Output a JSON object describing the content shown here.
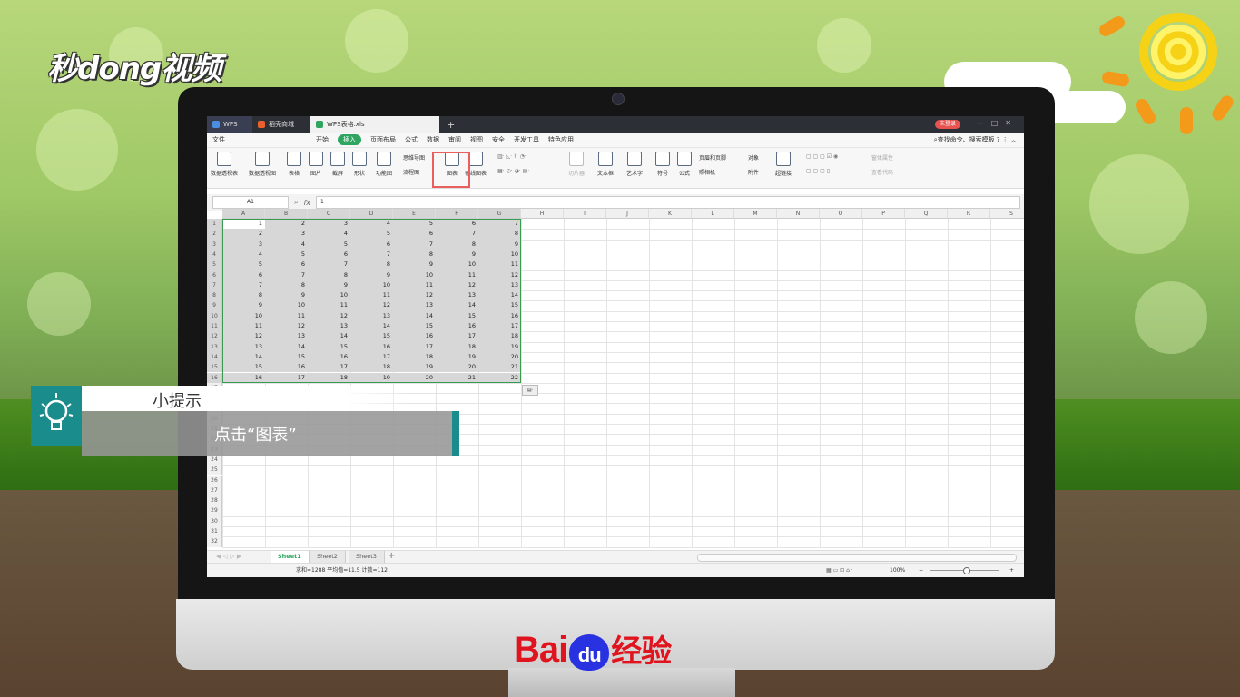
{
  "brand": {
    "top_logo": "秒dong视频",
    "baidu_logo_left": "Bai",
    "baidu_logo_paw": "du",
    "baidu_logo_right": "经验"
  },
  "tip": {
    "title": "小提示",
    "text": "点击“图表”"
  },
  "app": {
    "tabs": [
      {
        "label": "WPS"
      },
      {
        "label": "稻壳商城"
      },
      {
        "label": "WPS表格.xls"
      }
    ],
    "login_label": "未登录",
    "menu": [
      "文件",
      "开始",
      "插入",
      "页面布局",
      "公式",
      "数据",
      "审阅",
      "视图",
      "安全",
      "开发工具",
      "特色应用"
    ],
    "active_menu": "插入",
    "search_label": "查找命令、搜索模板",
    "ribbon": {
      "pivot_table": "数据透视表",
      "pivot_chart": "数据透视图",
      "table": "表格",
      "picture": "图片",
      "screenshot": "截屏",
      "shape": "形状",
      "function_chart": "功能图",
      "mindmap": "思维导图",
      "flowchart": "流程图",
      "chart": "图表",
      "online_chart": "在线图表",
      "slicer": "切片器",
      "textbox": "文本框",
      "wordart": "艺术字",
      "symbol": "符号",
      "formula": "公式",
      "header_footer": "页眉和页脚",
      "object": "对象",
      "camera": "照相机",
      "attachment": "附件",
      "hyperlink": "超链接",
      "form_props": "窗体属性",
      "view_code": "查看代码"
    },
    "name_box": "A1",
    "fx_label": "fx",
    "formula_value": "1",
    "columns": [
      "A",
      "B",
      "C",
      "D",
      "E",
      "F",
      "G",
      "H",
      "I",
      "J",
      "K",
      "L",
      "M",
      "N",
      "O",
      "P",
      "Q",
      "R",
      "S"
    ],
    "row_count": 32,
    "data_rows": [
      [
        1,
        2,
        3,
        4,
        5,
        6,
        7
      ],
      [
        2,
        3,
        4,
        5,
        6,
        7,
        8
      ],
      [
        3,
        4,
        5,
        6,
        7,
        8,
        9
      ],
      [
        4,
        5,
        6,
        7,
        8,
        9,
        10
      ],
      [
        5,
        6,
        7,
        8,
        9,
        10,
        11
      ],
      [
        6,
        7,
        8,
        9,
        10,
        11,
        12
      ],
      [
        7,
        8,
        9,
        10,
        11,
        12,
        13
      ],
      [
        8,
        9,
        10,
        11,
        12,
        13,
        14
      ],
      [
        9,
        10,
        11,
        12,
        13,
        14,
        15
      ],
      [
        10,
        11,
        12,
        13,
        14,
        15,
        16
      ],
      [
        11,
        12,
        13,
        14,
        15,
        16,
        17
      ],
      [
        12,
        13,
        14,
        15,
        16,
        17,
        18
      ],
      [
        13,
        14,
        15,
        16,
        17,
        18,
        19
      ],
      [
        14,
        15,
        16,
        17,
        18,
        19,
        20
      ],
      [
        15,
        16,
        17,
        18,
        19,
        20,
        21
      ],
      [
        16,
        17,
        18,
        19,
        20,
        21,
        22
      ]
    ],
    "sheets": [
      "Sheet1",
      "Sheet2",
      "Sheet3"
    ],
    "active_sheet": "Sheet1",
    "status_text": "求和=1288  平均值=11.5  计数=112",
    "zoom": "100%",
    "colors": {
      "accent": "#2fa561",
      "highlight": "#ea5e5e",
      "tip_teal": "#1b8c8c"
    }
  }
}
